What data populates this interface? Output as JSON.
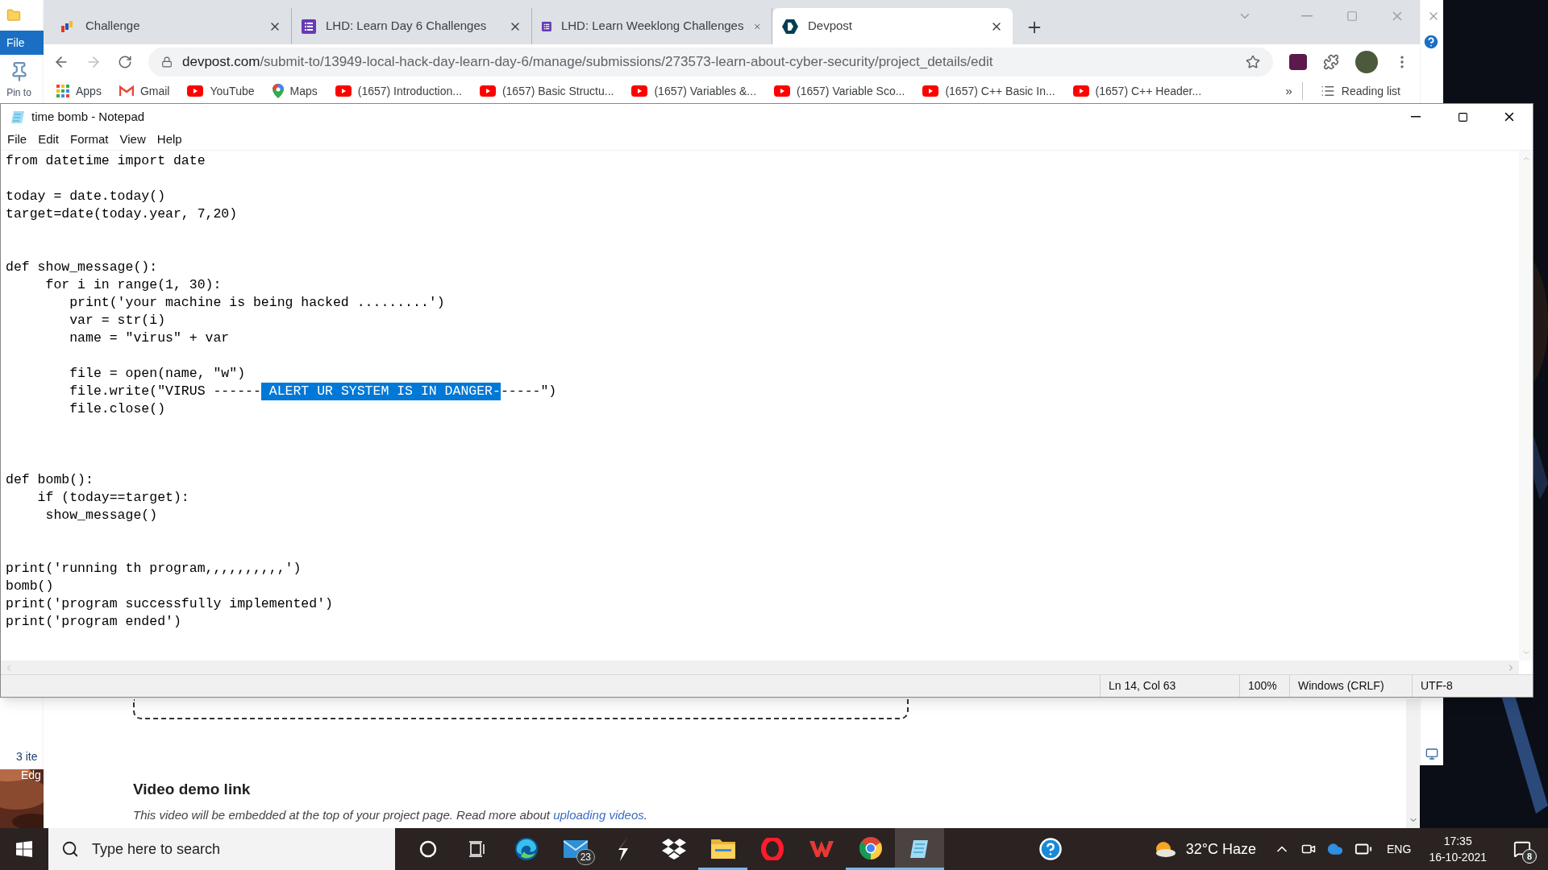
{
  "explorer": {
    "ribbon_tab": "File",
    "pin_label": "Pin to",
    "status": "3 ite",
    "desktop_label": "Edg"
  },
  "browser": {
    "tabs": [
      {
        "title": "Challenge",
        "kind": "mlh",
        "selected": false
      },
      {
        "title": "LHD: Learn Day 6 Challenges",
        "kind": "form",
        "selected": false
      },
      {
        "title": "LHD: Learn Weeklong Challenges",
        "kind": "form",
        "selected": false
      },
      {
        "title": "Devpost",
        "kind": "devpost",
        "selected": true
      }
    ],
    "address_host": "devpost.com",
    "address_path": "/submit-to/13949-local-hack-day-learn-day-6/manage/submissions/273573-learn-about-cyber-security/project_details/edit",
    "bookmarks": [
      {
        "label": "Apps",
        "kind": "apps"
      },
      {
        "label": "Gmail",
        "kind": "gmail"
      },
      {
        "label": "YouTube",
        "kind": "youtube"
      },
      {
        "label": "Maps",
        "kind": "maps"
      },
      {
        "label": "(1657) Introduction...",
        "kind": "youtube"
      },
      {
        "label": "(1657) Basic Structu...",
        "kind": "youtube"
      },
      {
        "label": "(1657) Variables &...",
        "kind": "youtube"
      },
      {
        "label": "(1657) Variable Sco...",
        "kind": "youtube"
      },
      {
        "label": "(1657) C++ Basic In...",
        "kind": "youtube"
      },
      {
        "label": "(1657) C++ Header...",
        "kind": "youtube"
      }
    ],
    "more": "»",
    "reading_list": "Reading list"
  },
  "page": {
    "heading": "Video demo link",
    "note": "This video will be embedded at the top of your project page. Read more about ",
    "link": "uploading videos",
    "note_end": "."
  },
  "notepad": {
    "title": "time bomb - Notepad",
    "menu": [
      "File",
      "Edit",
      "Format",
      "View",
      "Help"
    ],
    "lines": [
      {
        "kind": "code",
        "segments": [
          {
            "text": "from datetime import date",
            "selected": false
          }
        ]
      },
      {
        "kind": "blank"
      },
      {
        "kind": "code",
        "segments": [
          {
            "text": "today = date.today()",
            "selected": false
          }
        ]
      },
      {
        "kind": "code",
        "segments": [
          {
            "text": "target=date(today.year, 7,20)",
            "selected": false
          }
        ]
      },
      {
        "kind": "blank"
      },
      {
        "kind": "blank"
      },
      {
        "kind": "code",
        "segments": [
          {
            "text": "def show_message():",
            "selected": false
          }
        ]
      },
      {
        "kind": "code",
        "segments": [
          {
            "text": "     for i in range(1, 30):",
            "selected": false
          }
        ]
      },
      {
        "kind": "code",
        "segments": [
          {
            "text": "        print('your machine is being hacked .........')",
            "selected": false
          }
        ]
      },
      {
        "kind": "code",
        "segments": [
          {
            "text": "        var = str(i)",
            "selected": false
          }
        ]
      },
      {
        "kind": "code",
        "segments": [
          {
            "text": "        name = \"virus\" + var",
            "selected": false
          }
        ]
      },
      {
        "kind": "blank"
      },
      {
        "kind": "code",
        "segments": [
          {
            "text": "        file = open(name, \"w\")",
            "selected": false
          }
        ]
      },
      {
        "kind": "code",
        "segments": [
          {
            "text": "        file.write(\"VIRUS ------",
            "selected": false
          },
          {
            "text": " ALERT UR SYSTEM IS IN DANGER-",
            "selected": true
          },
          {
            "text": "-----\")",
            "selected": false
          }
        ]
      },
      {
        "kind": "code",
        "segments": [
          {
            "text": "        file.close()",
            "selected": false
          }
        ]
      },
      {
        "kind": "blank"
      },
      {
        "kind": "blank"
      },
      {
        "kind": "blank"
      },
      {
        "kind": "code",
        "segments": [
          {
            "text": "def bomb():",
            "selected": false
          }
        ]
      },
      {
        "kind": "code",
        "segments": [
          {
            "text": "    if (today==target):",
            "selected": false
          }
        ]
      },
      {
        "kind": "code",
        "segments": [
          {
            "text": "     show_message()",
            "selected": false
          }
        ]
      },
      {
        "kind": "blank"
      },
      {
        "kind": "blank"
      },
      {
        "kind": "code",
        "segments": [
          {
            "text": "print('running th program,,,,,,,,,,')",
            "selected": false
          }
        ]
      },
      {
        "kind": "code",
        "segments": [
          {
            "text": "bomb()",
            "selected": false
          }
        ]
      },
      {
        "kind": "code",
        "segments": [
          {
            "text": "print('program successfully implemented')",
            "selected": false
          }
        ]
      },
      {
        "kind": "code",
        "segments": [
          {
            "text": "print('program ended')",
            "selected": false
          }
        ]
      }
    ],
    "status": [
      "Ln 14, Col 63",
      "100%",
      "Windows (CRLF)",
      "UTF-8"
    ]
  },
  "taskbar": {
    "search_placeholder": "Type here to search",
    "apps": [
      {
        "kind": "cortana",
        "running": false,
        "selected": false
      },
      {
        "kind": "taskview",
        "running": false,
        "selected": false
      },
      {
        "kind": "edge",
        "running": false,
        "selected": false
      },
      {
        "kind": "mail",
        "running": false,
        "selected": false,
        "badge": "23"
      },
      {
        "kind": "s-app",
        "running": false,
        "selected": false
      },
      {
        "kind": "dropbox",
        "running": false,
        "selected": false
      },
      {
        "kind": "explorer",
        "running": true,
        "selected": false
      },
      {
        "kind": "opera",
        "running": false,
        "selected": false
      },
      {
        "kind": "wps",
        "running": false,
        "selected": false
      },
      {
        "kind": "chrome",
        "running": true,
        "selected": false
      },
      {
        "kind": "notepad",
        "running": true,
        "selected": true
      }
    ],
    "weather": "32°C Haze",
    "language": "ENG",
    "time": "17:35",
    "date": "16-10-2021",
    "notifications": "8"
  }
}
